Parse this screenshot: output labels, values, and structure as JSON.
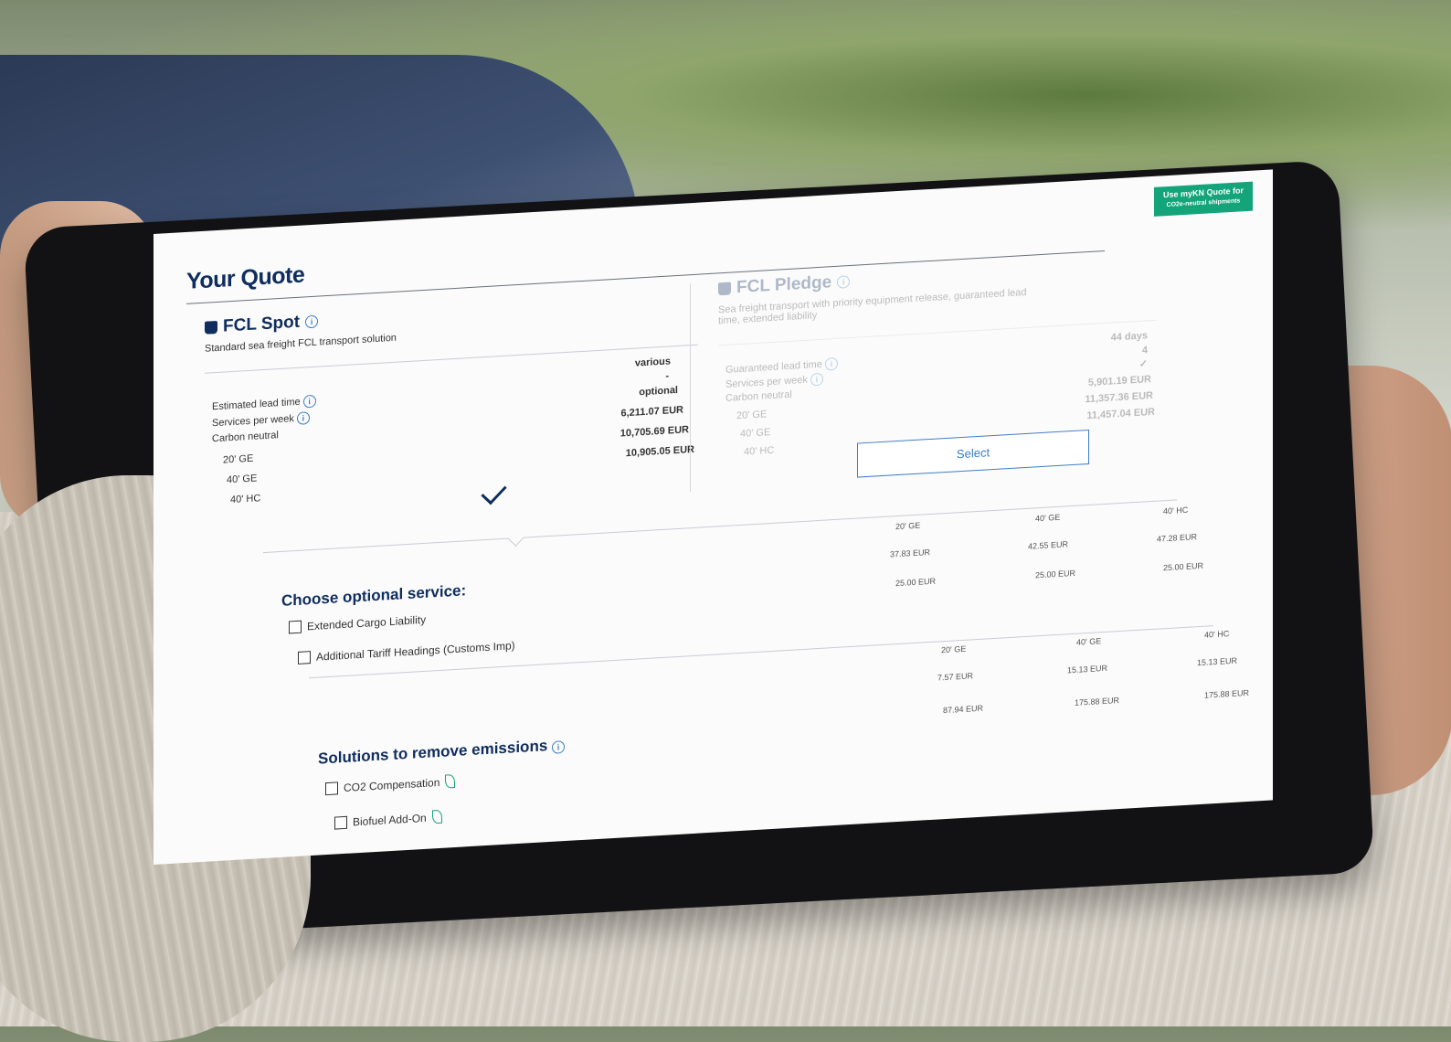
{
  "header": {
    "title": "Your Quote",
    "cta_line1": "Use myKN Quote for",
    "cta_line2": "CO2e-neutral shipments"
  },
  "spot": {
    "title": "FCL Spot",
    "subtitle": "Standard sea freight FCL transport solution",
    "rows": [
      {
        "label": "Estimated lead time",
        "value": "various"
      },
      {
        "label": "Services per week",
        "value": "-"
      },
      {
        "label": "Carbon neutral",
        "value": "optional"
      },
      {
        "label": "20' GE",
        "value": "6,211.07 EUR"
      },
      {
        "label": "40' GE",
        "value": "10,705.69 EUR"
      },
      {
        "label": "40' HC",
        "value": "10,905.05 EUR"
      }
    ]
  },
  "pledge": {
    "title": "FCL Pledge",
    "subtitle": "Sea freight transport with priority equipment release, guaranteed lead time, extended liability",
    "rows": [
      {
        "label": "Guaranteed lead time",
        "value": "44 days"
      },
      {
        "label": "Services per week",
        "value": "4"
      },
      {
        "label": "Carbon neutral",
        "value": "✓"
      },
      {
        "label": "20' GE",
        "value": "5,901.19 EUR"
      },
      {
        "label": "40' GE",
        "value": "11,357.36 EUR"
      },
      {
        "label": "40' HC",
        "value": "11,457.04 EUR"
      }
    ],
    "select_label": "Select"
  },
  "optional": {
    "heading": "Choose optional service:",
    "columns": [
      "20' GE",
      "40' GE",
      "40' HC"
    ],
    "items": [
      {
        "label": "Extended Cargo Liability",
        "prices": [
          "37.83 EUR",
          "42.55 EUR",
          "47.28 EUR"
        ]
      },
      {
        "label": "Additional Tariff Headings (Customs Imp)",
        "prices": [
          "25.00 EUR",
          "25.00 EUR",
          "25.00 EUR"
        ]
      }
    ]
  },
  "emissions": {
    "heading": "Solutions to remove emissions",
    "columns": [
      "20' GE",
      "40' GE",
      "40' HC"
    ],
    "items": [
      {
        "label": "CO2 Compensation",
        "prices": [
          "7.57 EUR",
          "15.13 EUR",
          "15.13 EUR"
        ]
      },
      {
        "label": "Biofuel Add-On",
        "prices": [
          "87.94 EUR",
          "175.88 EUR",
          "175.88 EUR"
        ]
      }
    ]
  },
  "colors": {
    "brand": "#0f2d5e",
    "accent": "#3b7ec8",
    "green": "#13a47a"
  },
  "icons": [
    "info-icon",
    "ship-icon",
    "checkmark-icon",
    "checkbox-icon",
    "leaf-icon"
  ]
}
